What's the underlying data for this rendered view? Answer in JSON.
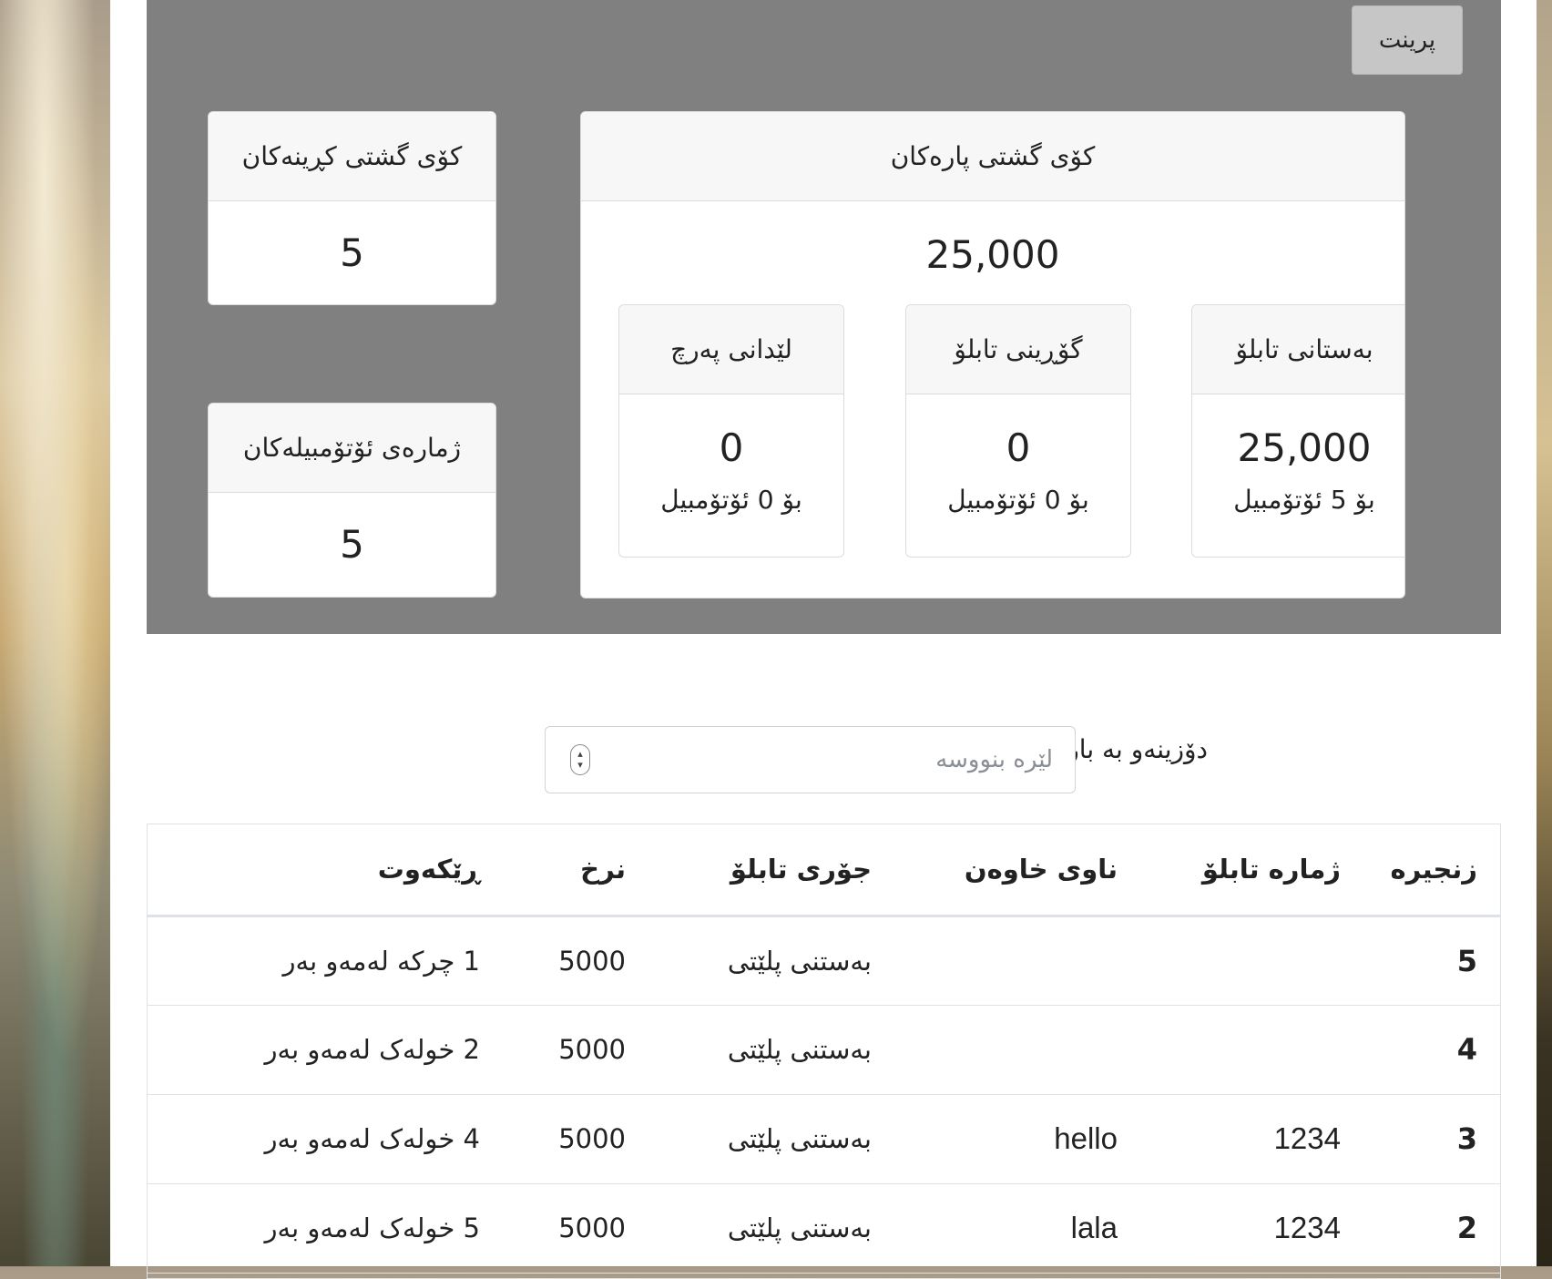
{
  "print_button": "پرینت",
  "total_money": {
    "title": "کۆی گشتی پارەکان",
    "value": "25,000",
    "breakdown": [
      {
        "title": "بەستانی تابلۆ",
        "value": "25,000",
        "caption": "بۆ 5 ئۆتۆمبیل"
      },
      {
        "title": "گۆڕینی تابلۆ",
        "value": "0",
        "caption": "بۆ 0 ئۆتۆمبیل"
      },
      {
        "title": "لێدانی پەرچ",
        "value": "0",
        "caption": "بۆ 0 ئۆتۆمبیل"
      }
    ]
  },
  "total_purchases": {
    "title": "کۆی گشتی کڕینەکان",
    "value": "5"
  },
  "car_count": {
    "title": "ژمارەی ئۆتۆمبیلەکان",
    "value": "5"
  },
  "search": {
    "label": "دۆزینەو بە بارکۆد",
    "placeholder": "لێرە بنووسە",
    "value": ""
  },
  "table": {
    "headers": [
      "زنجیرە",
      "ژمارە تابلۆ",
      "ناوی خاوەن",
      "جۆری تابلۆ",
      "نرخ",
      "ڕێکەوت"
    ],
    "rows": [
      [
        "5",
        "",
        "",
        "بەستنی پلێتی",
        "5000",
        "1 چرکە لەمەو بەر"
      ],
      [
        "4",
        "",
        "",
        "بەستنی پلێتی",
        "5000",
        "2 خولەک لەمەو بەر"
      ],
      [
        "3",
        "1234",
        "hello",
        "بەستنی پلێتی",
        "5000",
        "4 خولەک لەمەو بەر"
      ],
      [
        "2",
        "1234",
        "lala",
        "بەستنی پلێتی",
        "5000",
        "5 خولەک لەمەو بەر"
      ]
    ]
  }
}
